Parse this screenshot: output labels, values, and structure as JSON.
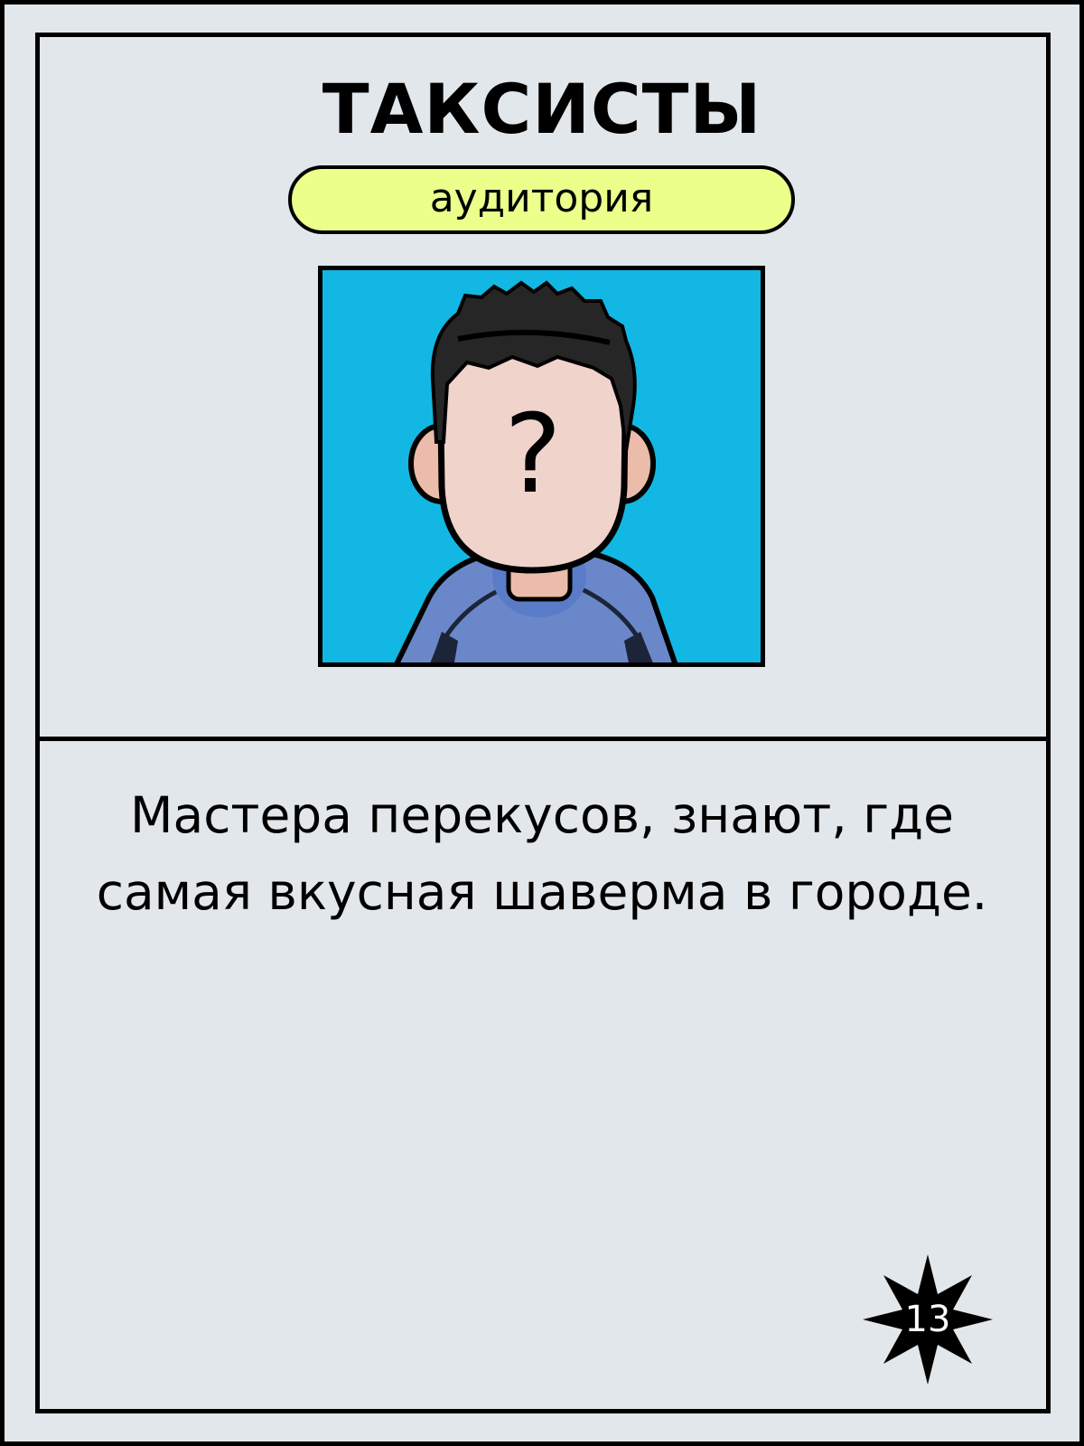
{
  "card": {
    "title": "ТАКСИСТЫ",
    "category": "аудитория",
    "avatar": {
      "icon": "anonymous-person-avatar",
      "face_mark": "?",
      "background_color": "#12b8e3"
    },
    "description": "Мастера перекусов, знают, где самая вкусная шаверма в городе.",
    "number": "13"
  },
  "colors": {
    "background": "#e2e7eb",
    "badge": "#ebff8a",
    "border": "#000000"
  }
}
